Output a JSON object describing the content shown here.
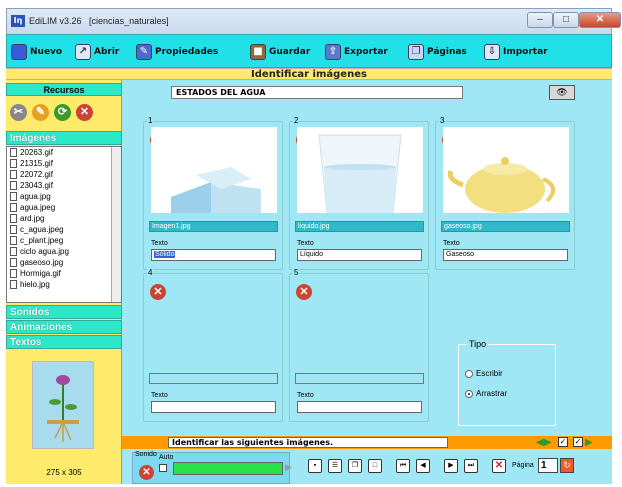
{
  "window": {
    "logo": "Iη",
    "title": "EdiLIM v3.26",
    "file": "[ciencias_naturales]",
    "min_glyph": "–",
    "max_glyph": "□",
    "close_glyph": "✕"
  },
  "toolbar": {
    "items": [
      {
        "label": "Nuevo",
        "icon": "new-book-icon",
        "color": "#3a5bd8",
        "glyph": "▬"
      },
      {
        "label": "Abrir",
        "icon": "open-folder-icon",
        "color": "#dfe7ff",
        "glyph": "↗"
      },
      {
        "label": "Propiedades",
        "icon": "properties-icon",
        "color": "#4a6ad0",
        "glyph": "✎"
      },
      {
        "label": "Guardar",
        "icon": "save-box-icon",
        "color": "#8a6b3a",
        "glyph": "■"
      },
      {
        "label": "Exportar",
        "icon": "export-icon",
        "color": "#5a7ad0",
        "glyph": "⇪"
      },
      {
        "label": "Páginas",
        "icon": "pages-icon",
        "color": "#c9d6f7",
        "glyph": "❐"
      },
      {
        "label": "Importar",
        "icon": "import-icon",
        "color": "#dfe7ff",
        "glyph": "⇩"
      }
    ]
  },
  "section_title": "Identificar imágenes",
  "sidebar": {
    "header": "Recursos",
    "tools": [
      {
        "name": "scissors-icon",
        "glyph": "✂",
        "color": "#777"
      },
      {
        "name": "edit-icon",
        "glyph": "✎",
        "color": "#e8a020"
      },
      {
        "name": "refresh-icon",
        "glyph": "⟳",
        "color": "#3a9a2a"
      },
      {
        "name": "delete-icon",
        "glyph": "✕",
        "color": "#c43"
      }
    ],
    "sections": [
      "Imágenes",
      "Sonidos",
      "Animaciones",
      "Textos"
    ],
    "files": [
      "20263.gif",
      "21315.gif",
      "22072.gif",
      "23043.gif",
      "agua.jpg",
      "agua.jpeg",
      "ard.jpg",
      "c_agua.jpeg",
      "c_plant.jpeg",
      "ciclo agua.jpg",
      "gaseoso.jpg",
      "Hormiga.gif",
      "hielo.jpg"
    ],
    "thumb_size": "275 x 305"
  },
  "main": {
    "title_value": "ESTADOS DEL AGUA",
    "eye_glyph": "👁",
    "text_label": "Texto",
    "cards": [
      {
        "num": "1",
        "filename": "Imagen1.jpg",
        "text": "Sólido"
      },
      {
        "num": "2",
        "filename": "liquido.jpg",
        "text": "Líquido"
      },
      {
        "num": "3",
        "filename": "gaseoso.jpg",
        "text": "Gaseoso"
      },
      {
        "num": "4",
        "filename": "",
        "text": ""
      },
      {
        "num": "5",
        "filename": "",
        "text": ""
      }
    ],
    "tipo": {
      "label": "Tipo",
      "options": [
        "Escribir",
        "Arrastrar"
      ],
      "selected": "Arrastrar"
    },
    "instruction": "Identificar las siguientes imágenes.",
    "sound_label": "Sonido",
    "auto_label": "Auto",
    "page_label": "Página",
    "page_value": "1"
  }
}
